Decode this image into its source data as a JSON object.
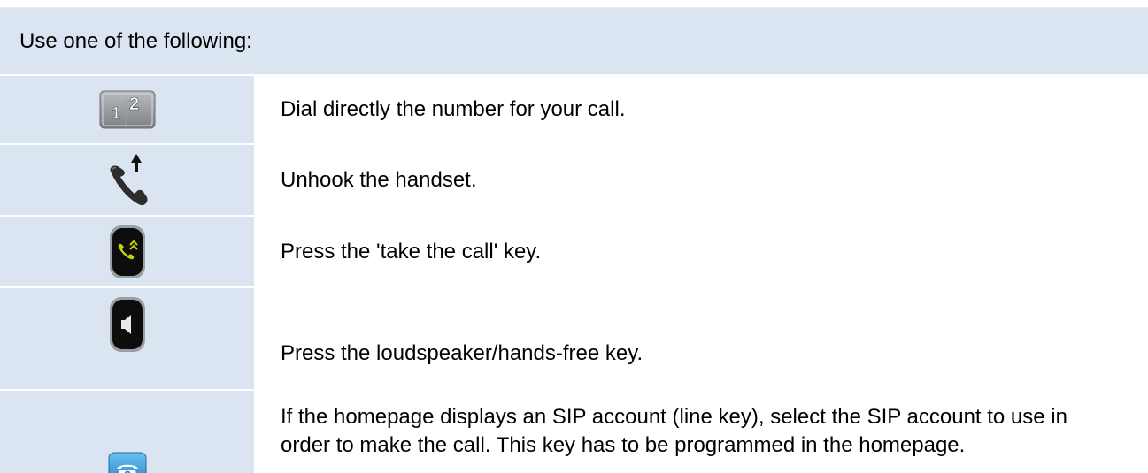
{
  "header": {
    "text": "Use one of the following:"
  },
  "rows": [
    {
      "icon": "keypad-icon",
      "text": "Dial directly the number for your call."
    },
    {
      "icon": "handset-offhook-icon",
      "text": "Unhook the handset."
    },
    {
      "icon": "take-call-key-icon",
      "text": "Press the 'take the call' key."
    },
    {
      "icon": "loudspeaker-key-icon",
      "text": "Press the loudspeaker/hands-free key."
    },
    {
      "icon": "sip-line-key-icon",
      "text": "If the homepage displays an SIP account (line key), select the SIP account to use in order to make the call. This key has to be programmed in the homepage."
    }
  ],
  "colors": {
    "header_bg": "#dbe5f1",
    "icon_cell_bg": "#dbe5f1",
    "text_cell_bg": "#ffffff",
    "take_call_green": "#c8d400",
    "sip_key_blue": "#2a8fd6"
  }
}
